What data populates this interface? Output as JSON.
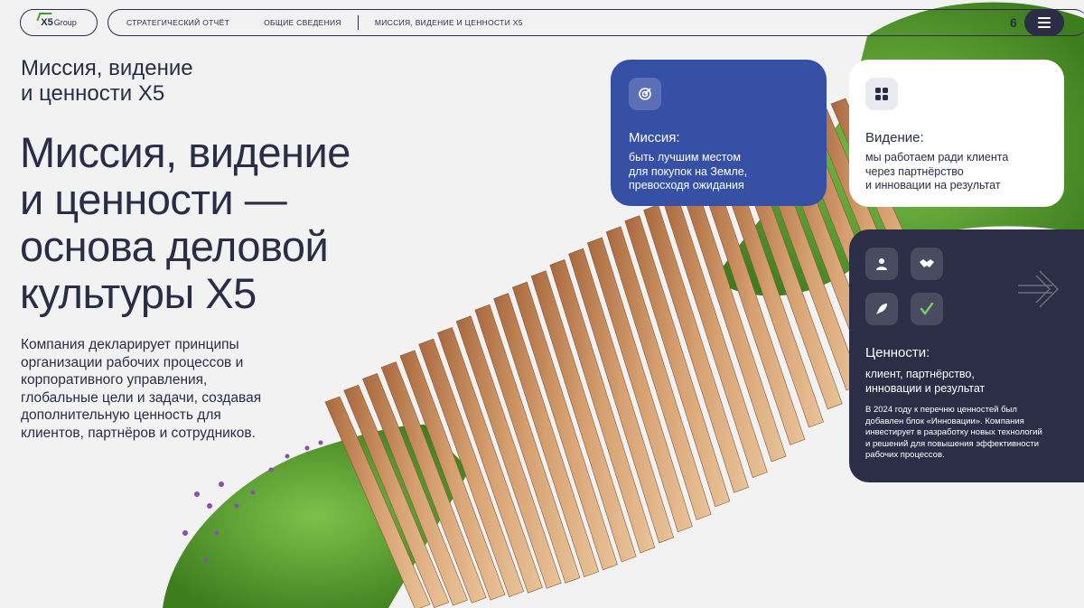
{
  "header": {
    "logo_mark": "X5",
    "logo_word": "Group",
    "breadcrumbs": [
      {
        "label": "СТРАТЕГИЧЕСКИЙ ОТЧЁТ"
      },
      {
        "label": "ОБЩИЕ СВЕДЕНИЯ"
      },
      {
        "label": "МИССИЯ, ВИДЕНИЕ И ЦЕННОСТИ X5"
      }
    ],
    "page_number": "6",
    "menu_icon": "hamburger-icon"
  },
  "section": {
    "title_line1": "Миссия, видение",
    "title_line2": "и ценности X5"
  },
  "headline": {
    "line1": "Миссия, видение",
    "line2": "и ценности —",
    "line3": "основа деловой",
    "line4": "культуры X5"
  },
  "intro": {
    "text": "Компания декларирует принципы организации рабочих процессов и корпоративного управления, глобальные цели и задачи, создавая дополнительную ценность для клиентов, партнёров и сотрудников."
  },
  "cards": {
    "mission": {
      "icon": "target-icon",
      "title": "Миссия:",
      "line1": "быть лучшим местом",
      "line2": "для покупок на Земле,",
      "line3": "превосходя ожидания",
      "color": "#3650a6"
    },
    "vision": {
      "icon": "grid-icon",
      "title": "Видение:",
      "line1": "мы работаем ради клиента",
      "line2": "через партнёрство",
      "line3": "и инновации на результат",
      "color": "#ffffff"
    },
    "values": {
      "icons": [
        "person-icon",
        "handshake-icon",
        "rocket-icon",
        "checkmark-icon"
      ],
      "title": "Ценности:",
      "line1": "клиент, партнёрство,",
      "line2": "инновации и результат",
      "note": "В 2024 году к перечню ценностей был добавлен блок «Инновации». Компания инвестирует в разработку новых технологий и решений для повышения эффективности рабочих процессов.",
      "color": "#2c2e48",
      "check_color": "#7bc96f"
    }
  },
  "colors": {
    "ink": "#2a2d45",
    "background": "#f2f2f2",
    "grass": "#4f9a2c",
    "wood": "#c98b5a"
  }
}
